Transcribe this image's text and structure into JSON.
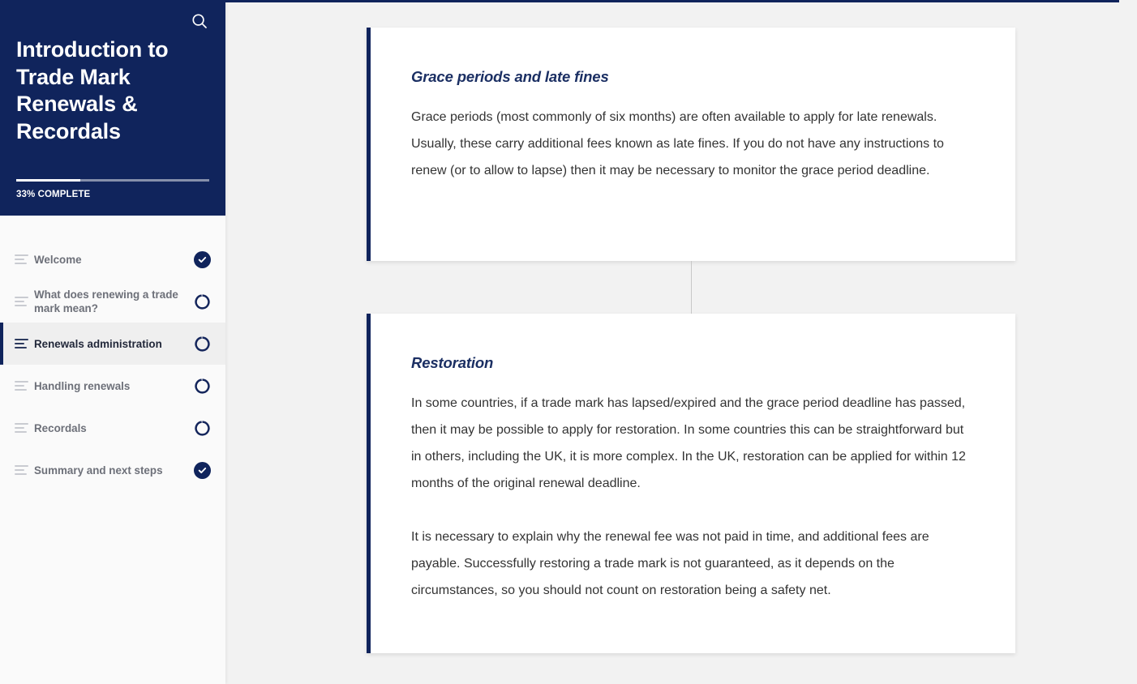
{
  "sidebar": {
    "search_icon": "search-icon",
    "course_title": "Introduction to Trade Mark Renewals & Recordals",
    "progress": {
      "percent": 33,
      "label": "33% COMPLETE",
      "fill_color": "#ffffff",
      "track_color": "#8690ab"
    },
    "header_bg": "#10245c",
    "items": [
      {
        "label": "Welcome",
        "icon": "lines-icon",
        "status": "complete",
        "status_icon": "check-circle-icon",
        "active": false
      },
      {
        "label": "What does renewing a trade mark mean?",
        "icon": "lines-icon",
        "status": "incomplete",
        "status_icon": "empty-circle-icon",
        "active": false
      },
      {
        "label": "Renewals administration",
        "icon": "lines-icon",
        "status": "incomplete",
        "status_icon": "empty-circle-icon",
        "active": true
      },
      {
        "label": "Handling renewals",
        "icon": "lines-icon",
        "status": "incomplete",
        "status_icon": "empty-circle-icon",
        "active": false
      },
      {
        "label": "Recordals",
        "icon": "lines-icon",
        "status": "incomplete",
        "status_icon": "empty-circle-icon",
        "active": false
      },
      {
        "label": "Summary and next steps",
        "icon": "lines-icon",
        "status": "complete",
        "status_icon": "check-circle-icon",
        "active": false
      }
    ]
  },
  "main": {
    "top_progress": {
      "percent": 98,
      "color": "#10245c"
    },
    "accent_color": "#10245c",
    "cards": [
      {
        "heading": "Grace periods and late fines",
        "paragraphs": [
          "Grace periods (most commonly of six months) are often available to apply for late renewals. Usually, these carry additional fees known as late fines. If you do not have any instructions to renew (or to allow to lapse) then it may be necessary to monitor the grace period deadline."
        ]
      },
      {
        "heading": "Restoration",
        "paragraphs": [
          "In some countries, if a trade mark has lapsed/expired and the grace period deadline has passed, then it may be possible to apply for restoration. In some countries this can be straightforward but in others, including the UK, it is more complex. In the UK, restoration can be applied for within 12 months of the original renewal deadline.",
          "It is necessary to explain why the renewal fee was not paid in time, and additional fees are payable. Successfully restoring a trade mark is not guaranteed, as it depends on the circumstances, so you should not count on restoration being a safety net."
        ]
      }
    ]
  }
}
